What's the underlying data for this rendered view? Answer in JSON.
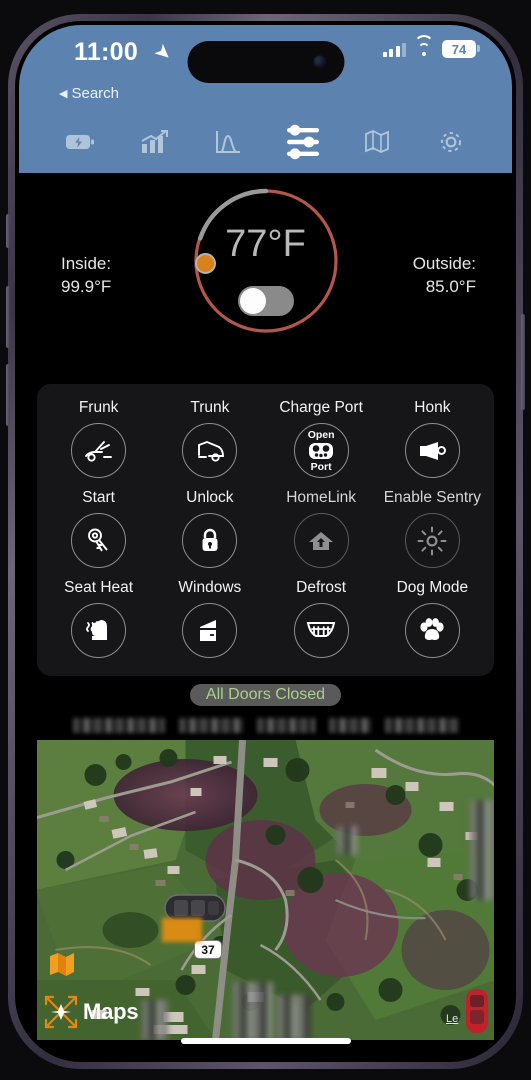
{
  "status_bar": {
    "time": "11:00",
    "location_arrow_icon": "location-arrow-icon",
    "back_label": "Search",
    "back_chevron_icon": "chevron-left-icon",
    "signal_icon": "cellular-bars-icon",
    "wifi_icon": "wifi-icon",
    "battery_level": "74",
    "battery_icon": "battery-icon",
    "header_color": "#5c83b0"
  },
  "tab_bar": {
    "tabs": [
      {
        "name": "charge",
        "icon": "battery-charging-icon",
        "active": false
      },
      {
        "name": "stats",
        "icon": "chart-bar-icon",
        "active": false
      },
      {
        "name": "graph",
        "icon": "graph-curve-icon",
        "active": false
      },
      {
        "name": "controls",
        "icon": "sliders-icon",
        "active": true
      },
      {
        "name": "map",
        "icon": "map-icon",
        "active": false
      },
      {
        "name": "settings",
        "icon": "gear-icon",
        "active": false
      }
    ]
  },
  "climate": {
    "inside_label": "Inside:",
    "inside_temp": "99.9°F",
    "outside_label": "Outside:",
    "outside_temp": "85.0°F",
    "target_temp": "77°F",
    "dial_handle_color": "#d9821a",
    "dial_arc_hot_color": "#b5564a",
    "dial_arc_cool_color": "#9a9a9a",
    "toggle_state": "off",
    "toggle_icon": "power-toggle-icon"
  },
  "controls": {
    "rows": [
      [
        {
          "label": "Frunk",
          "icon": "frunk-open-icon",
          "dim": false
        },
        {
          "label": "Trunk",
          "icon": "trunk-open-icon",
          "dim": false
        },
        {
          "label": "Charge Port",
          "icon": "charge-port-icon",
          "dim": false,
          "inner_top": "Open",
          "inner_bottom": "Port"
        },
        {
          "label": "Honk",
          "icon": "horn-icon",
          "dim": false
        }
      ],
      [
        {
          "label": "Start",
          "icon": "car-keys-icon",
          "dim": false
        },
        {
          "label": "Unlock",
          "icon": "lock-icon",
          "dim": false
        },
        {
          "label": "HomeLink",
          "icon": "home-icon",
          "dim": true
        },
        {
          "label": "Enable Sentry",
          "icon": "sentry-mode-icon",
          "dim": true
        }
      ],
      [
        {
          "label": "Seat Heat",
          "icon": "heated-seat-icon",
          "dim": false
        },
        {
          "label": "Windows",
          "icon": "car-window-icon",
          "dim": false
        },
        {
          "label": "Defrost",
          "icon": "defrost-icon",
          "dim": false
        },
        {
          "label": "Dog Mode",
          "icon": "paw-print-icon",
          "dim": false
        }
      ]
    ]
  },
  "door_status": {
    "text": "All Doors Closed",
    "text_color": "#a9d18b",
    "pill_color": "#5a5a5a"
  },
  "redacted_info_row": {
    "note": "redacted",
    "blocks": [
      92,
      64,
      58,
      42,
      74
    ]
  },
  "map": {
    "highway_shield": "37",
    "attribution_label": "Maps",
    "attribution_icon": "maps-compass-icon",
    "logo_icon": "apple-maps-logo-icon",
    "vehicle_marker_icon": "vehicle-marker-icon",
    "red_car_icon": "red-car-icon",
    "red_car_label": "Le",
    "view_type": "satellite"
  },
  "home_indicator": "home-bar"
}
